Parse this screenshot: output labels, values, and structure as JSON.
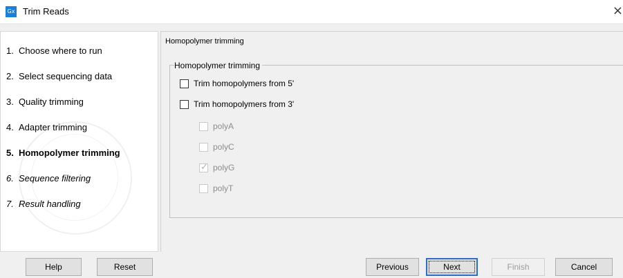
{
  "window": {
    "title": "Trim Reads",
    "icon_text": "Gx",
    "close_glyph": "×"
  },
  "sidebar": {
    "steps": [
      {
        "num": "1.",
        "label": "Choose where to run"
      },
      {
        "num": "2.",
        "label": "Select sequencing data"
      },
      {
        "num": "3.",
        "label": "Quality trimming"
      },
      {
        "num": "4.",
        "label": "Adapter trimming"
      },
      {
        "num": "5.",
        "label": "Homopolymer trimming"
      },
      {
        "num": "6.",
        "label": "Sequence filtering"
      },
      {
        "num": "7.",
        "label": "Result handling"
      }
    ]
  },
  "content": {
    "title": "Homopolymer trimming",
    "group_legend": "Homopolymer trimming",
    "options": [
      {
        "label": "Trim homopolymers from 5'",
        "checked": false,
        "enabled": true
      },
      {
        "label": "Trim homopolymers from 3'",
        "checked": false,
        "enabled": true
      },
      {
        "label": "polyA",
        "checked": false,
        "enabled": false
      },
      {
        "label": "polyC",
        "checked": false,
        "enabled": false
      },
      {
        "label": "polyG",
        "checked": true,
        "enabled": false
      },
      {
        "label": "polyT",
        "checked": false,
        "enabled": false
      }
    ]
  },
  "buttons": {
    "help": "Help",
    "reset": "Reset",
    "previous": "Previous",
    "next": "Next",
    "finish": "Finish",
    "cancel": "Cancel"
  },
  "colors": {
    "accent": "#2d6fc8",
    "app_icon": "#1c7fd6"
  }
}
